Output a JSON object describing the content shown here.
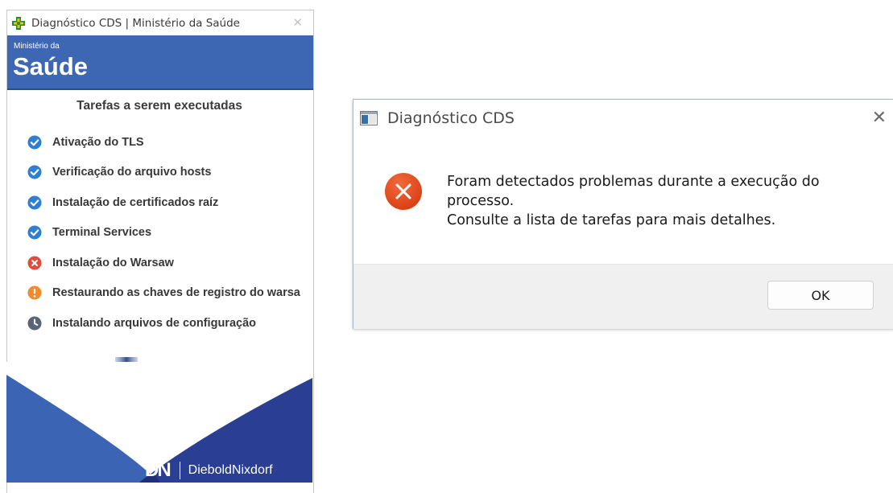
{
  "main_window": {
    "title": "Diagnóstico CDS | Ministério da Saúde",
    "banner": {
      "ministerio": "Ministério da",
      "saude": "Saúde"
    },
    "tasks_heading": "Tarefas a serem executadas",
    "tasks": [
      {
        "label": "Ativação do TLS",
        "status": "success",
        "icon": "check-circle-icon"
      },
      {
        "label": "Verificação do arquivo hosts",
        "status": "success",
        "icon": "check-circle-icon"
      },
      {
        "label": "Instalação de certificados raíz",
        "status": "success",
        "icon": "check-circle-icon"
      },
      {
        "label": "Terminal Services",
        "status": "success",
        "icon": "check-circle-icon"
      },
      {
        "label": "Instalação do Warsaw",
        "status": "error",
        "icon": "x-circle-icon"
      },
      {
        "label": "Restaurando as chaves de registro do warsa",
        "status": "warning",
        "icon": "exclamation-circle-icon"
      },
      {
        "label": "Instalando arquivos de configuração",
        "status": "pending",
        "icon": "clock-icon"
      }
    ],
    "brand": {
      "mark": "DN",
      "name": "DieboldNixdorf"
    }
  },
  "dialog": {
    "title": "Diagnóstico CDS",
    "message_lines": [
      "Foram detectados problemas durante a execução do",
      "processo.",
      "Consulte a lista de tarefas para mais detalhes."
    ],
    "ok_label": "OK"
  },
  "colors": {
    "banner_blue": "#3d66b3",
    "success": "#2f7fd0",
    "error": "#e24b3b",
    "warning": "#f28a2e",
    "pending": "#5a6476",
    "dialog_error": "#e8461f"
  }
}
